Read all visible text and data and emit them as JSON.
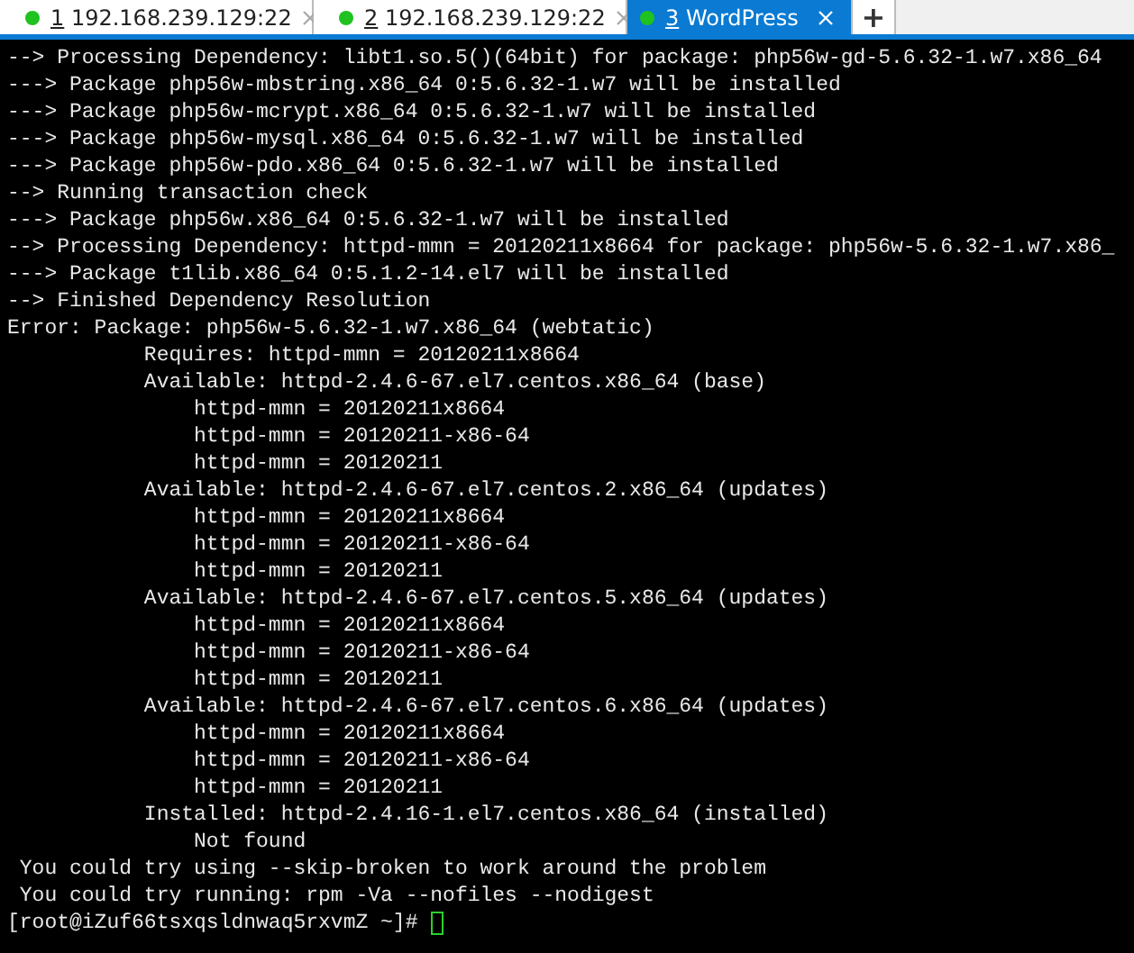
{
  "tabs": [
    {
      "number": "1",
      "label": "192.168.239.129:22",
      "selected": false,
      "connected": true
    },
    {
      "number": "2",
      "label": "192.168.239.129:22",
      "selected": false,
      "connected": true
    },
    {
      "number": "3",
      "label": "WordPress",
      "selected": true,
      "connected": true
    }
  ],
  "new_tab": "+",
  "terminal": {
    "lines": [
      "--> Processing Dependency: libt1.so.5()(64bit) for package: php56w-gd-5.6.32-1.w7.x86_64",
      "---> Package php56w-mbstring.x86_64 0:5.6.32-1.w7 will be installed",
      "---> Package php56w-mcrypt.x86_64 0:5.6.32-1.w7 will be installed",
      "---> Package php56w-mysql.x86_64 0:5.6.32-1.w7 will be installed",
      "---> Package php56w-pdo.x86_64 0:5.6.32-1.w7 will be installed",
      "--> Running transaction check",
      "---> Package php56w.x86_64 0:5.6.32-1.w7 will be installed",
      "--> Processing Dependency: httpd-mmn = 20120211x8664 for package: php56w-5.6.32-1.w7.x86_",
      "---> Package t1lib.x86_64 0:5.1.2-14.el7 will be installed",
      "--> Finished Dependency Resolution",
      "Error: Package: php56w-5.6.32-1.w7.x86_64 (webtatic)",
      "           Requires: httpd-mmn = 20120211x8664",
      "           Available: httpd-2.4.6-67.el7.centos.x86_64 (base)",
      "               httpd-mmn = 20120211x8664",
      "               httpd-mmn = 20120211-x86-64",
      "               httpd-mmn = 20120211",
      "           Available: httpd-2.4.6-67.el7.centos.2.x86_64 (updates)",
      "               httpd-mmn = 20120211x8664",
      "               httpd-mmn = 20120211-x86-64",
      "               httpd-mmn = 20120211",
      "           Available: httpd-2.4.6-67.el7.centos.5.x86_64 (updates)",
      "               httpd-mmn = 20120211x8664",
      "               httpd-mmn = 20120211-x86-64",
      "               httpd-mmn = 20120211",
      "           Available: httpd-2.4.6-67.el7.centos.6.x86_64 (updates)",
      "               httpd-mmn = 20120211x8664",
      "               httpd-mmn = 20120211-x86-64",
      "               httpd-mmn = 20120211",
      "           Installed: httpd-2.4.16-1.el7.centos.x86_64 (installed)",
      "               Not found",
      " You could try using --skip-broken to work around the problem",
      " You could try running: rpm -Va --nofiles --nodigest"
    ],
    "prompt": "[root@iZuf66tsxqsldnwaq5rxvmZ ~]# "
  }
}
